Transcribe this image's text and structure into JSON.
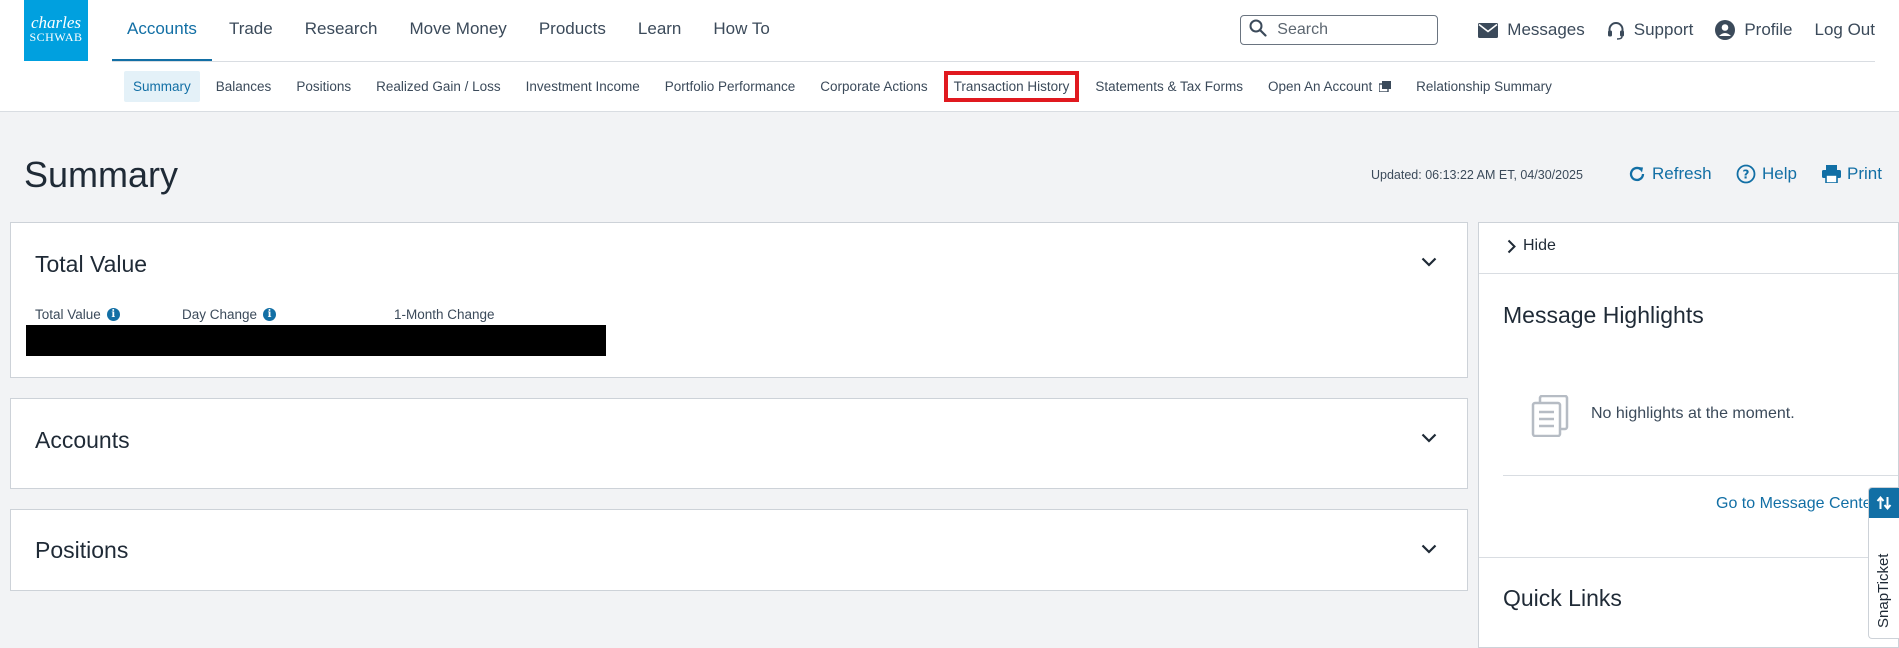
{
  "brand": {
    "line1": "charles",
    "line2": "SCHWAB"
  },
  "main_nav": [
    {
      "label": "Accounts",
      "active": true
    },
    {
      "label": "Trade"
    },
    {
      "label": "Research"
    },
    {
      "label": "Move Money"
    },
    {
      "label": "Products"
    },
    {
      "label": "Learn"
    },
    {
      "label": "How To"
    }
  ],
  "header_right": {
    "search_placeholder": "Search",
    "messages": "Messages",
    "support": "Support",
    "profile": "Profile",
    "logout": "Log Out"
  },
  "sub_nav": [
    {
      "label": "Summary",
      "active": true
    },
    {
      "label": "Balances"
    },
    {
      "label": "Positions"
    },
    {
      "label": "Realized Gain / Loss"
    },
    {
      "label": "Investment Income"
    },
    {
      "label": "Portfolio Performance"
    },
    {
      "label": "Corporate Actions"
    },
    {
      "label": "Transaction History",
      "highlighted": true
    },
    {
      "label": "Statements & Tax Forms"
    },
    {
      "label": "Open An Account",
      "external": true
    },
    {
      "label": "Relationship Summary"
    }
  ],
  "page": {
    "title": "Summary",
    "updated": "Updated: 06:13:22 AM ET, 04/30/2025",
    "refresh": "Refresh",
    "help": "Help",
    "print": "Print"
  },
  "total_value": {
    "heading": "Total Value",
    "labels": {
      "total_value": "Total Value",
      "day_change": "Day Change",
      "month_change": "1-Month Change"
    }
  },
  "accounts": {
    "heading": "Accounts"
  },
  "positions": {
    "heading": "Positions"
  },
  "sidebar": {
    "hide": "Hide",
    "message_highlights": "Message Highlights",
    "no_highlights": "No highlights at the moment.",
    "go_to_message_center": "Go to Message Center",
    "quick_links": "Quick Links"
  },
  "snap_ticket": {
    "label": "SnapTicket"
  },
  "colors": {
    "accent": "#126fa5",
    "brand": "#00a0df",
    "highlight_box": "#e0191f"
  }
}
